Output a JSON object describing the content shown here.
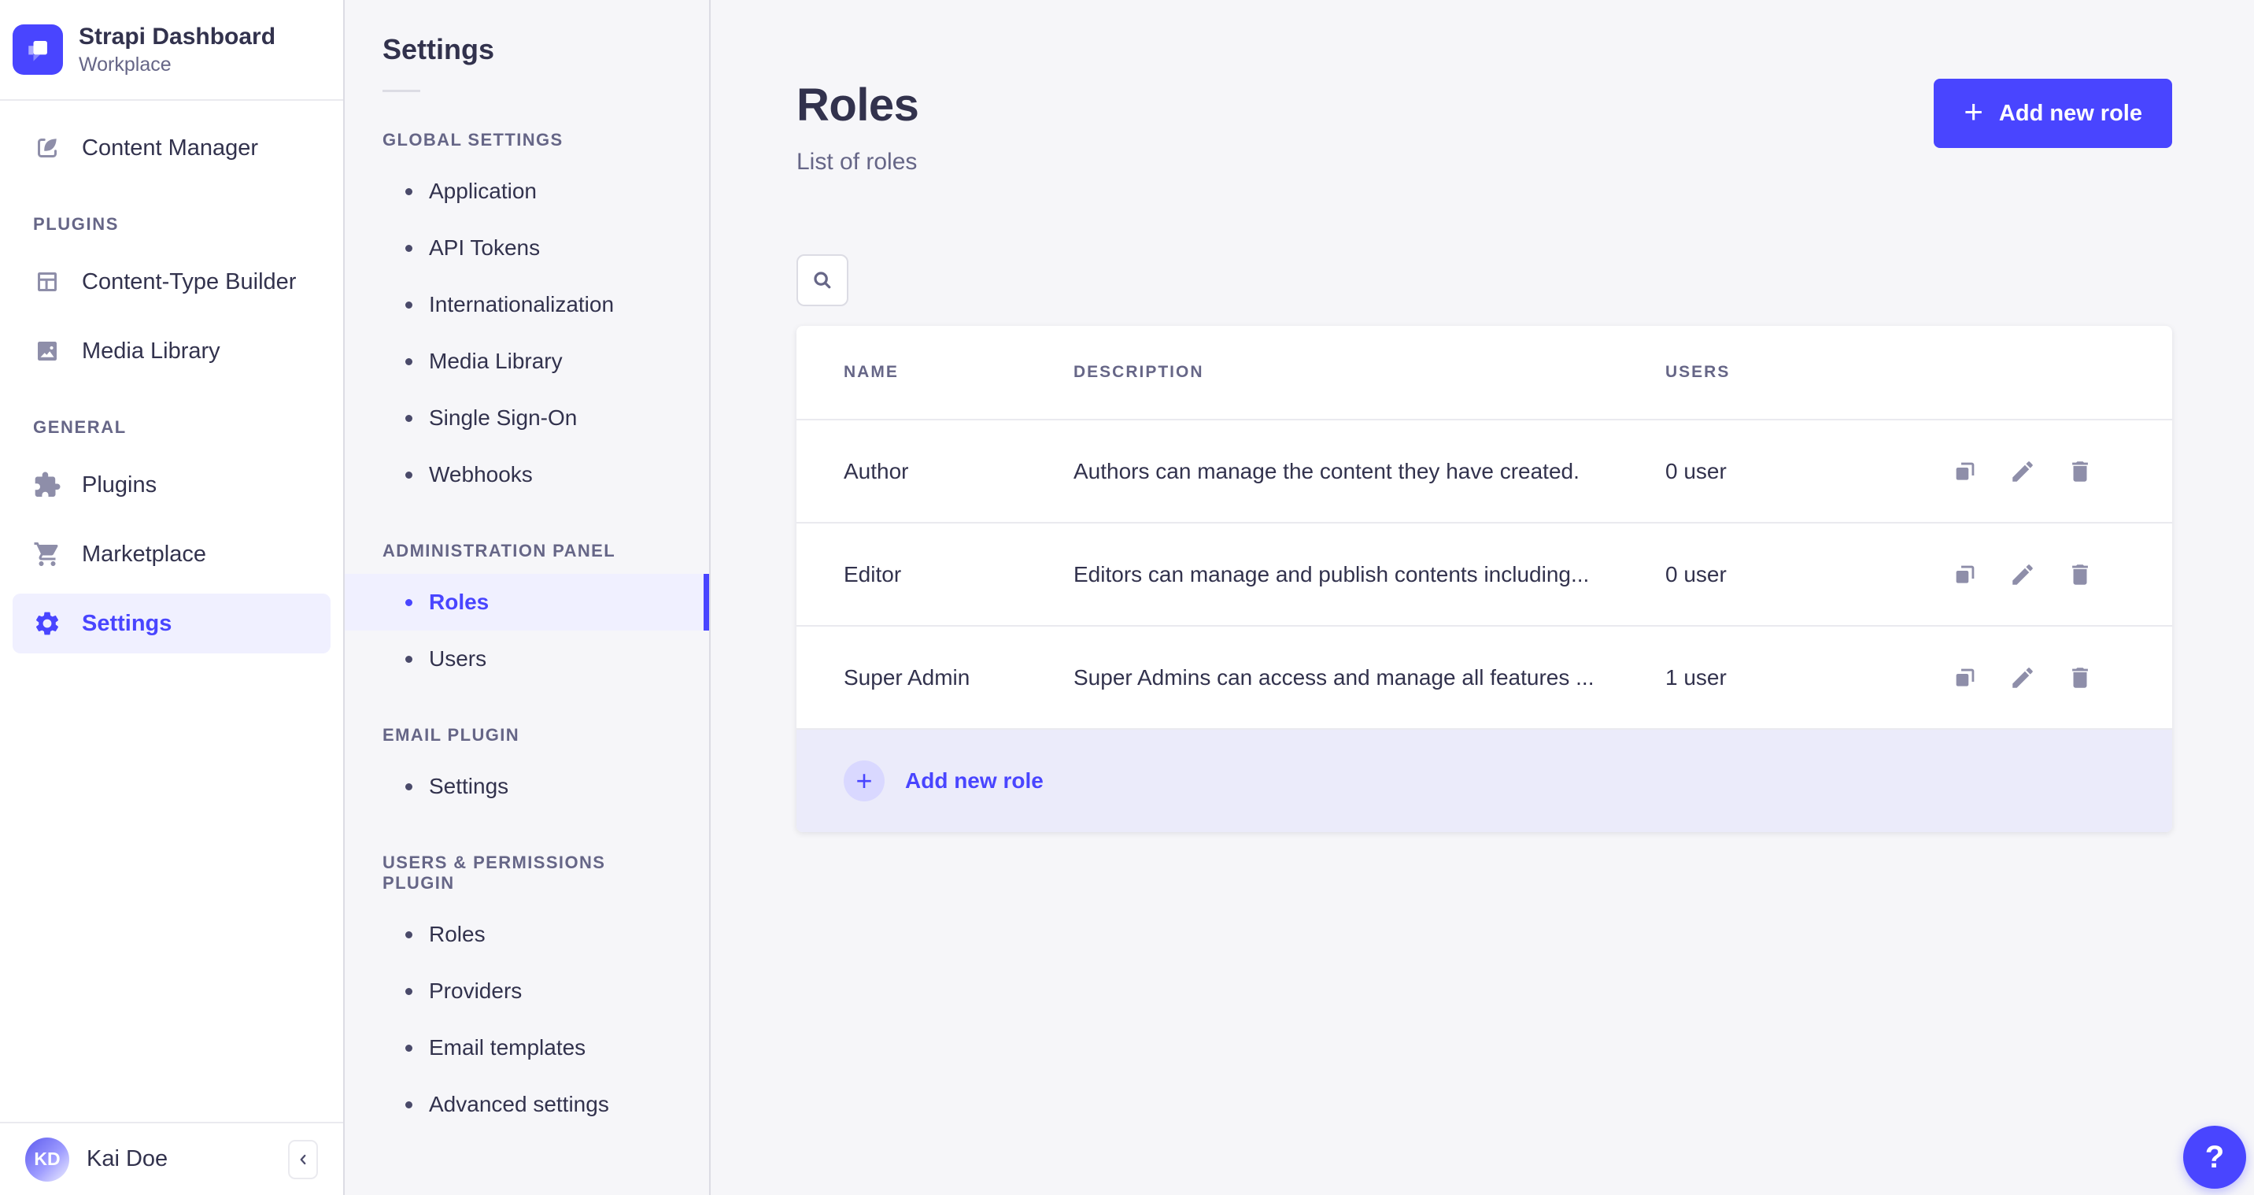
{
  "app": {
    "name": "Strapi Dashboard",
    "workspace": "Workplace"
  },
  "colors": {
    "primary": "#4945ff",
    "primary_light": "#f0f0ff",
    "primary_badge": "#d9d8ff",
    "footer_row_bg": "#ebebfa",
    "text_dark": "#32324d",
    "text_muted": "#666687",
    "icon_gray": "#8e8ea9",
    "page_bg": "#f6f6f9",
    "border": "#dcdce4"
  },
  "icons": {
    "plus": "+",
    "help": "?"
  },
  "sidebar": {
    "content_manager_label": "Content Manager",
    "sections": [
      {
        "title": "PLUGINS",
        "items": [
          {
            "label": "Content-Type Builder"
          },
          {
            "label": "Media Library"
          }
        ]
      },
      {
        "title": "GENERAL",
        "items": [
          {
            "label": "Plugins"
          },
          {
            "label": "Marketplace"
          },
          {
            "label": "Settings"
          }
        ]
      }
    ],
    "user": {
      "name": "Kai Doe",
      "initials": "KD"
    }
  },
  "subnav": {
    "title": "Settings",
    "sections": [
      {
        "title": "GLOBAL SETTINGS",
        "items": [
          {
            "label": "Application"
          },
          {
            "label": "API Tokens"
          },
          {
            "label": "Internationalization"
          },
          {
            "label": "Media Library"
          },
          {
            "label": "Single Sign-On"
          },
          {
            "label": "Webhooks"
          }
        ]
      },
      {
        "title": "ADMINISTRATION PANEL",
        "items": [
          {
            "label": "Roles"
          },
          {
            "label": "Users"
          }
        ]
      },
      {
        "title": "EMAIL PLUGIN",
        "items": [
          {
            "label": "Settings"
          }
        ]
      },
      {
        "title": "USERS & PERMISSIONS PLUGIN",
        "items": [
          {
            "label": "Roles"
          },
          {
            "label": "Providers"
          },
          {
            "label": "Email templates"
          },
          {
            "label": "Advanced settings"
          }
        ]
      }
    ]
  },
  "main": {
    "title": "Roles",
    "subtitle": "List of roles",
    "add_button_label": "Add new role",
    "table": {
      "headers": [
        "NAME",
        "DESCRIPTION",
        "USERS"
      ],
      "rows": [
        {
          "name": "Author",
          "description": "Authors can manage the content they have created.",
          "users": "0 user"
        },
        {
          "name": "Editor",
          "description": "Editors can manage and publish contents including...",
          "users": "0 user"
        },
        {
          "name": "Super Admin",
          "description": "Super Admins can access and manage all features ...",
          "users": "1 user"
        }
      ],
      "footer_add_label": "Add new role"
    }
  },
  "help": {
    "label": "?"
  }
}
